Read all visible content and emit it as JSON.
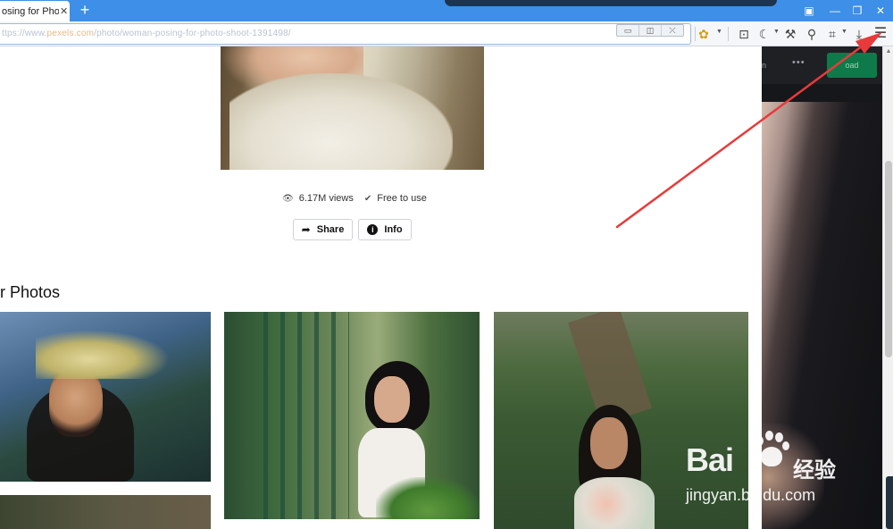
{
  "browser": {
    "tab_title": "osing for Photo",
    "tab_close": "✕",
    "new_tab": "+",
    "address_prefix": "ttps://www.",
    "address_host": "pexels.com",
    "address_path": "/photo/woman-posing-for-photo-shoot-1391498/",
    "pip_buttons": [
      "▭",
      "◫",
      "⤫"
    ],
    "window_controls": [
      "▣",
      "—",
      "❐",
      "✕"
    ],
    "toolbar_icons": [
      "extension-icon",
      "screenshot-icon",
      "night-mode-icon",
      "tools-icon",
      "search-icon",
      "crop-icon",
      "download-icon",
      "menu-icon"
    ]
  },
  "photo": {
    "views_icon": "👁",
    "views": "6.17M views",
    "license_icon": "✔",
    "license": "Free to use",
    "share_icon": "➦",
    "share_label": "Share",
    "info_icon": "i",
    "info_label": "Info"
  },
  "section": {
    "title": "r Photos"
  },
  "dark_panel": {
    "text": "n",
    "dots": "•••",
    "button": "oad"
  },
  "watermark": {
    "logo": "Bai",
    "cn": "经验",
    "url": "jingyan.baidu.com"
  },
  "colors": {
    "tabbar": "#3d8fe8",
    "arrow": "#e83a3a",
    "dark_panel": "#16171a",
    "download_button": "#0e7a4a"
  }
}
